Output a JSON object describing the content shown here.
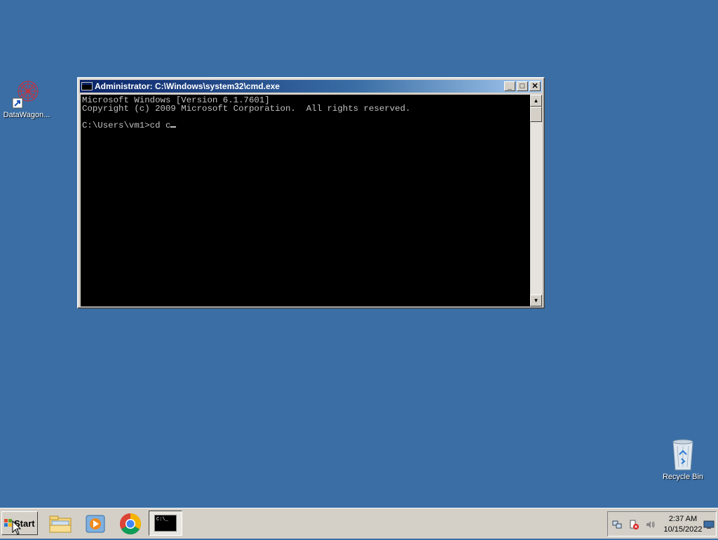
{
  "desktop": {
    "icons": [
      {
        "label": "DataWagon...",
        "icon": "datawagon-shortcut-icon"
      },
      {
        "label": "Recycle Bin",
        "icon": "recycle-bin-icon"
      }
    ]
  },
  "window": {
    "title": "Administrator: C:\\Windows\\system32\\cmd.exe",
    "controls": {
      "minimize": "_",
      "maximize": "□",
      "close": "✕"
    },
    "console_lines": [
      "Microsoft Windows [Version 6.1.7601]",
      "Copyright (c) 2009 Microsoft Corporation.  All rights reserved.",
      "",
      "C:\\Users\\vm1>cd c"
    ],
    "scroll_up": "▲",
    "scroll_down": "▼"
  },
  "taskbar": {
    "start_label": "Start",
    "quick_launch": [
      "file-explorer-icon",
      "media-player-icon",
      "chrome-icon"
    ],
    "active_task_preview": "C:\\_",
    "tray": {
      "time": "2:37 AM",
      "date": "10/15/2022"
    }
  },
  "colors": {
    "desktop": "#3a6ea5",
    "titlebar_start": "#0a246a",
    "console_bg": "#000000",
    "console_fg": "#c0c0c0"
  }
}
